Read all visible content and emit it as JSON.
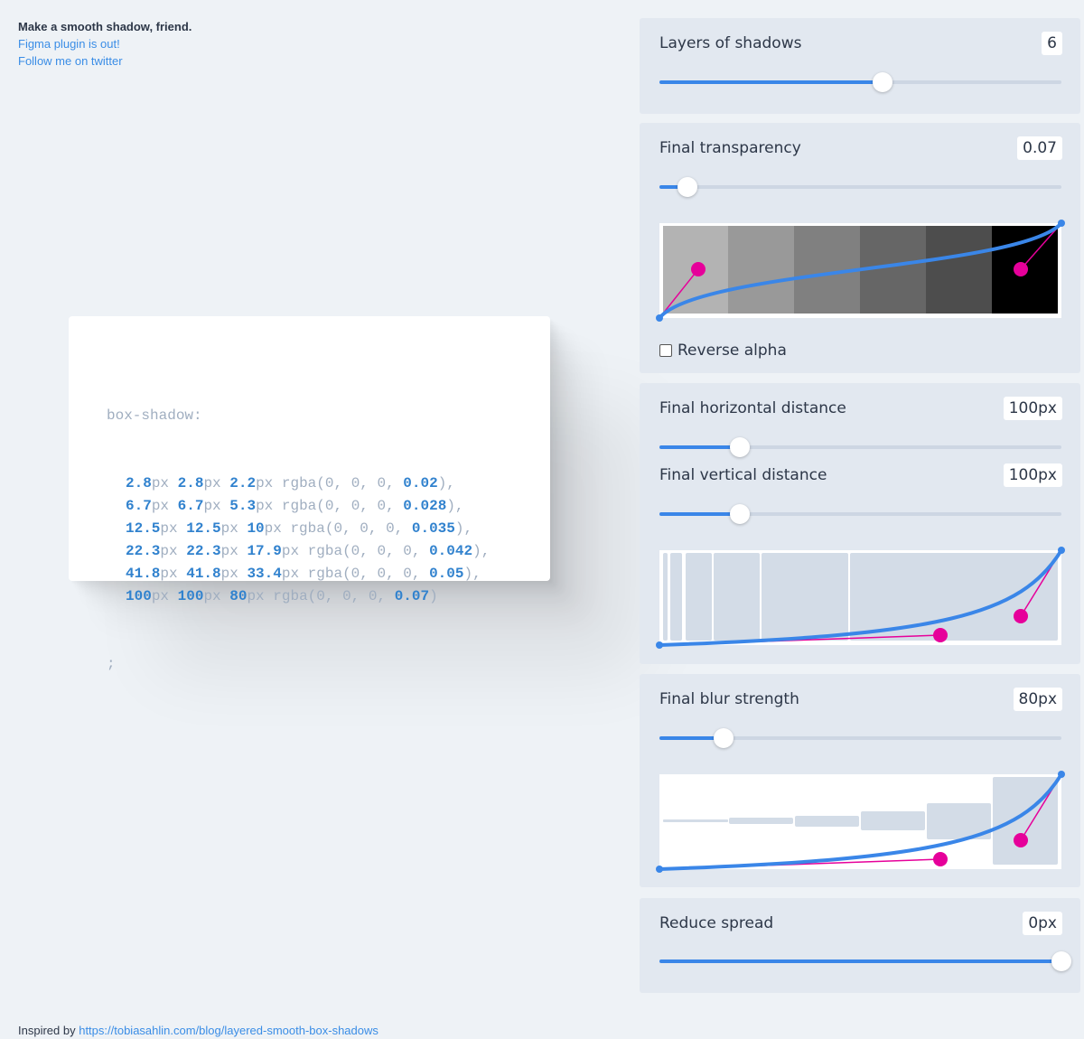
{
  "header": {
    "tagline": "Make a smooth shadow, friend.",
    "figma_link": "Figma plugin is out!",
    "twitter_link": "Follow me on twitter"
  },
  "code": {
    "property": "box-shadow:",
    "terminator": ";",
    "layers": [
      {
        "x": "2.8",
        "y": "2.8",
        "blur": "2.2",
        "alpha": "0.02",
        "sep": "),"
      },
      {
        "x": "6.7",
        "y": "6.7",
        "blur": "5.3",
        "alpha": "0.028",
        "sep": "),"
      },
      {
        "x": "12.5",
        "y": "12.5",
        "blur": "10",
        "alpha": "0.035",
        "sep": "),"
      },
      {
        "x": "22.3",
        "y": "22.3",
        "blur": "17.9",
        "alpha": "0.042",
        "sep": "),"
      },
      {
        "x": "41.8",
        "y": "41.8",
        "blur": "33.4",
        "alpha": "0.05",
        "sep": "),"
      },
      {
        "x": "100",
        "y": "100",
        "blur": "80",
        "alpha": "0.07",
        "sep": ")"
      }
    ],
    "unit": "px",
    "rgba_prefix": "rgba(0, 0, 0, "
  },
  "controls": {
    "layers": {
      "label": "Layers of shadows",
      "value": "6",
      "level": 0.555
    },
    "transparency": {
      "label": "Final transparency",
      "value": "0.07",
      "level": 0.07
    },
    "reverse_alpha": {
      "label": "Reverse alpha",
      "checked": false
    },
    "horizontal": {
      "label": "Final horizontal distance",
      "value": "100px",
      "level": 0.2
    },
    "vertical": {
      "label": "Final vertical distance",
      "value": "100px",
      "level": 0.2
    },
    "blur": {
      "label": "Final blur strength",
      "value": "80px",
      "level": 0.16
    },
    "spread": {
      "label": "Reduce spread",
      "value": "0px",
      "level": 1.0
    }
  },
  "colors": {
    "accent": "#3a86e8",
    "handle": "#e6009a",
    "panel": "#e2e8f0"
  },
  "footer": {
    "prefix": "Inspired by",
    "link": "https://tobiasahlin.com/blog/layered-smooth-box-shadows"
  }
}
